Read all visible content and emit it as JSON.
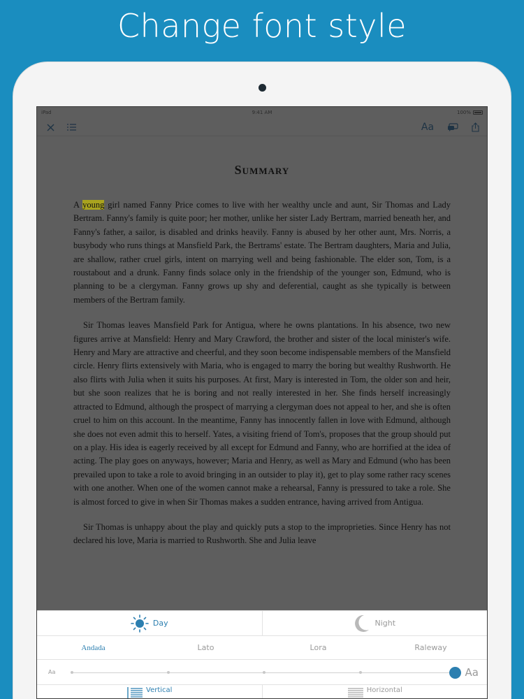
{
  "headline": "Change font style",
  "status": {
    "carrier": "iPad",
    "time": "9:41 AM",
    "battery": "100%"
  },
  "toolbar": {
    "close": "close-icon",
    "toc": "list-icon",
    "font_settings": "Aa",
    "notes": "notes-icon",
    "share": "share-icon"
  },
  "reader": {
    "title": "Summary",
    "highlight": "young",
    "p1_start": "A ",
    "p1_rest": " girl named Fanny Price comes to live with her wealthy uncle and aunt, Sir Thomas and Lady Bertram. Fanny's family is quite poor; her mother, unlike her sister Lady Bertram, married beneath her, and Fanny's father, a sailor, is disabled and drinks heavily. Fanny is abused by her other aunt, Mrs. Norris, a busybody who runs things at Mansfield Park, the Bertrams' estate. The Bertram daughters, Maria and Julia, are shallow, rather cruel girls, intent on marrying well and being fashionable. The elder son, Tom, is a roustabout and a drunk. Fanny finds solace only in the friendship of the younger son, Edmund, who is planning to be a clergyman. Fanny grows up shy and deferential, caught as she typically is between members of the Bertram family.",
    "p2": "Sir Thomas leaves Mansfield Park for Antigua, where he owns plantations. In his absence, two new figures arrive at Mansfield: Henry and Mary Crawford, the brother and sister of the local minister's wife. Henry and Mary are attractive and cheerful, and they soon become indispensable members of the Mansfield circle. Henry flirts extensively with Maria, who is engaged to marry the boring but wealthy Rushworth. He also flirts with Julia when it suits his purposes. At first, Mary is interested in Tom, the older son and heir, but she soon realizes that he is boring and not really interested in her. She finds herself increasingly attracted to Edmund, although the prospect of marrying a clergyman does not appeal to her, and she is often cruel to him on this account. In the meantime, Fanny has innocently fallen in love with Edmund, although she does not even admit this to herself. Yates, a visiting friend of Tom's, proposes that the group should put on a play. His idea is eagerly received by all except for Edmund and Fanny, who are horrified at the idea of acting. The play goes on anyways, however; Maria and Henry, as well as Mary and Edmund (who has been prevailed upon to take a role to avoid bringing in an outsider to play it), get to play some rather racy scenes with one another. When one of the women cannot make a rehearsal, Fanny is pressured to take a role. She is almost forced to give in when Sir Thomas makes a sudden entrance, having arrived from Antigua.",
    "p3": "Sir Thomas is unhappy about the play and quickly puts a stop to the improprieties. Since Henry has not declared his love, Maria is married to Rushworth. She and Julia leave"
  },
  "panel": {
    "theme_day": "Day",
    "theme_night": "Night",
    "fonts": [
      "Andada",
      "Lato",
      "Lora",
      "Raleway"
    ],
    "active_font": "Andada",
    "size_small": "Aa",
    "size_large": "Aa",
    "font_size_level": 1.0,
    "layout_vertical": "Vertical",
    "layout_horizontal": "Horizontal"
  },
  "colors": {
    "accent": "#2c7fb0",
    "background": "#1a8dbf",
    "highlight": "#a9a31f"
  }
}
